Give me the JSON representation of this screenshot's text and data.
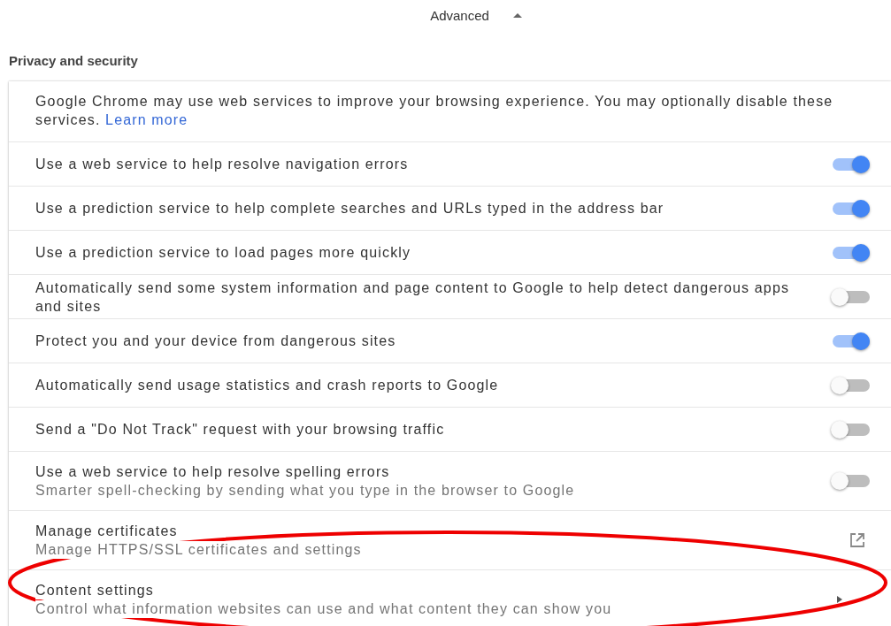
{
  "header": {
    "label": "Advanced",
    "expanded": true
  },
  "section_title": "Privacy and security",
  "intro": {
    "text": "Google Chrome may use web services to improve your browsing experience. You may optionally disable these services.",
    "link": "Learn more"
  },
  "rows": [
    {
      "kind": "toggle",
      "label": "Use a web service to help resolve navigation errors",
      "on": true,
      "highlighted": false
    },
    {
      "kind": "toggle",
      "label": "Use a prediction service to help complete searches and URLs typed in the address bar",
      "on": true,
      "highlighted": false
    },
    {
      "kind": "toggle",
      "label": "Use a prediction service to load pages more quickly",
      "on": true,
      "highlighted": false
    },
    {
      "kind": "toggle",
      "label": "Automatically send some system information and page content to Google to help detect dangerous apps and sites",
      "on": false,
      "highlighted": false
    },
    {
      "kind": "toggle",
      "label": "Protect you and your device from dangerous sites",
      "on": true,
      "highlighted": false
    },
    {
      "kind": "toggle",
      "label": "Automatically send usage statistics and crash reports to Google",
      "on": false,
      "highlighted": false
    },
    {
      "kind": "toggle",
      "label": "Send a \"Do Not Track\" request with your browsing traffic",
      "on": false,
      "highlighted": false
    },
    {
      "kind": "toggle",
      "label": "Use a web service to help resolve spelling errors",
      "sublabel": "Smarter spell-checking by sending what you type in the browser to Google",
      "on": false,
      "highlighted": false
    },
    {
      "kind": "external",
      "label": "Manage certificates",
      "sublabel": "Manage HTTPS/SSL certificates and settings",
      "highlighted": false
    },
    {
      "kind": "submenu",
      "label": "Content settings",
      "sublabel": "Control what information websites can use and what content they can show you",
      "highlighted": true
    }
  ]
}
